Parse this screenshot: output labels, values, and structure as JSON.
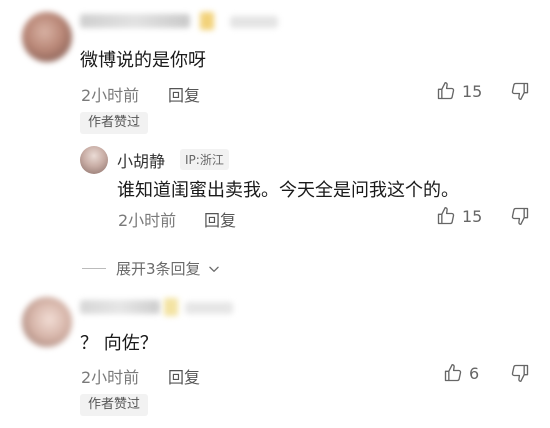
{
  "comments": [
    {
      "username": "",
      "text": "微博说的是你呀",
      "time": "2小时前",
      "reply_label": "回复",
      "likes": "15",
      "badge": "作者赞过",
      "replies": [
        {
          "username": "小胡静",
          "ip": "IP:浙江",
          "text": "谁知道闺蜜出卖我。今天全是问我这个的。",
          "time": "2小时前",
          "reply_label": "回复",
          "likes": "15"
        }
      ],
      "expand_label": "展开3条回复"
    },
    {
      "username": "",
      "text": "？ 向佐？",
      "time": "2小时前",
      "reply_label": "回复",
      "likes": "6",
      "badge": "作者赞过"
    }
  ],
  "icons": {
    "like": "thumbs-up-icon",
    "dislike": "thumbs-down-icon",
    "expand": "chevron-down-icon"
  }
}
